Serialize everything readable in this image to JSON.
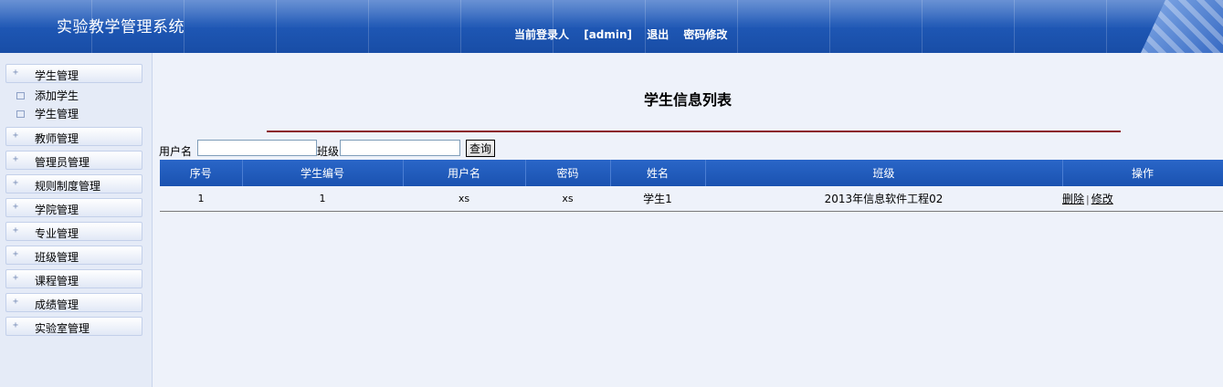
{
  "header": {
    "app_title": "实验教学管理系统",
    "current_user_label": "当前登录人",
    "current_user": "[admin]",
    "logout_label": "退出",
    "change_password_label": "密码修改"
  },
  "sidebar": {
    "menus": [
      {
        "label": "学生管理",
        "expanded": true,
        "children": [
          "添加学生",
          "学生管理"
        ]
      },
      {
        "label": "教师管理"
      },
      {
        "label": "管理员管理"
      },
      {
        "label": "规则制度管理"
      },
      {
        "label": "学院管理"
      },
      {
        "label": "专业管理"
      },
      {
        "label": "班级管理"
      },
      {
        "label": "课程管理"
      },
      {
        "label": "成绩管理"
      },
      {
        "label": "实验室管理"
      }
    ]
  },
  "main": {
    "page_title": "学生信息列表",
    "search": {
      "username_label": "用户名",
      "username_value": "",
      "class_label": "班级",
      "class_value": "",
      "query_button": "查询"
    },
    "table": {
      "columns": [
        "序号",
        "学生编号",
        "用户名",
        "密码",
        "姓名",
        "班级",
        "操作"
      ],
      "rows": [
        {
          "index": "1",
          "student_no": "1",
          "username": "xs",
          "password": "xs",
          "name": "学生1",
          "class": "2013年信息软件工程02",
          "delete_label": "删除",
          "edit_label": "修改"
        }
      ]
    }
  },
  "colors": {
    "header_blue": "#1f58b6",
    "table_header_blue": "#2a66c8",
    "title_rule": "#8b1a2a",
    "page_background": "#eef2fa"
  }
}
